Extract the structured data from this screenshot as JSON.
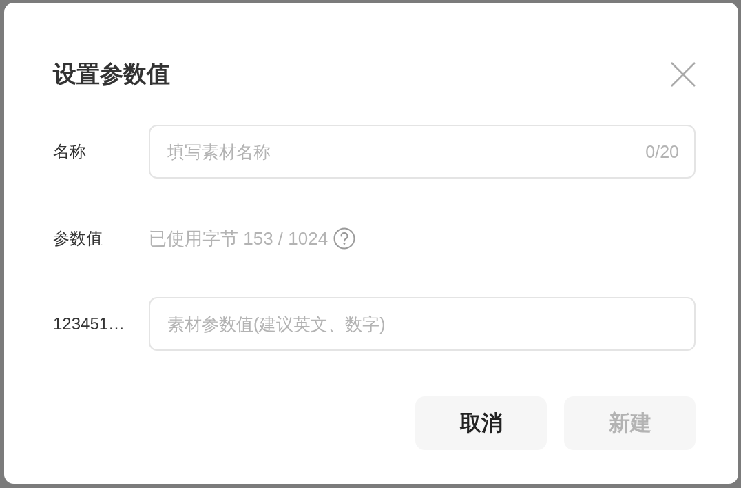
{
  "dialog": {
    "title": "设置参数值"
  },
  "rows": [
    {
      "kind": "input",
      "label": "名称",
      "placeholder": "填写素材名称",
      "counter": "0/20"
    },
    {
      "kind": "info",
      "label": "参数值",
      "text": "已使用字节 153 / 1024"
    },
    {
      "kind": "input",
      "label": "123451…",
      "placeholder": "素材参数值(建议英文、数字)"
    }
  ],
  "buttons": [
    {
      "label": "取消",
      "disabled": false
    },
    {
      "label": "新建",
      "disabled": true
    }
  ]
}
